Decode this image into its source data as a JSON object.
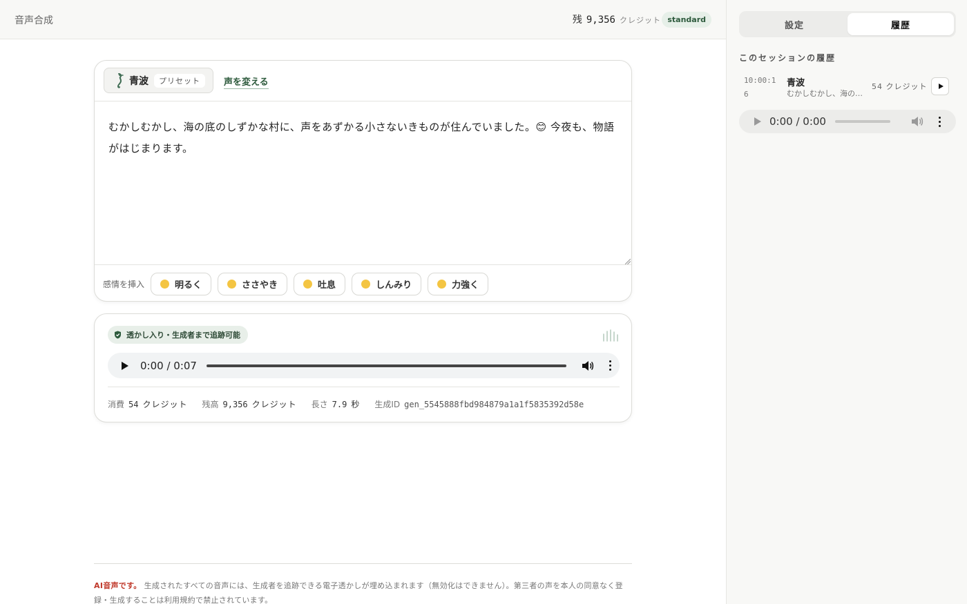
{
  "header": {
    "app_title": "音声合成",
    "credits_prefix": "残",
    "credits_value": "9,356",
    "credits_unit": "クレジット",
    "plan": "standard"
  },
  "editor": {
    "voice_name": "青波",
    "voice_tag": "プリセット",
    "change_voice": "声を変える",
    "text": "むかしむかし、海の底のしずかな村に、声をあずかる小さないきものが住んでいました。😊 今夜も、物語がはじまります。",
    "emotion_label": "感情を挿入",
    "emotions": [
      {
        "label": "明るく",
        "icon": "bright-face-icon",
        "color": "#f4c542"
      },
      {
        "label": "ささやき",
        "icon": "whisper-face-icon",
        "color": "#f4c542"
      },
      {
        "label": "吐息",
        "icon": "sigh-face-icon",
        "color": "#f4c542"
      },
      {
        "label": "しんみり",
        "icon": "sad-face-icon",
        "color": "#f4c542"
      },
      {
        "label": "力強く",
        "icon": "strong-face-icon",
        "color": "#f4c542"
      }
    ]
  },
  "output": {
    "watermark_badge": "透かし入り・生成者まで追跡可能",
    "player_time": "0:00 / 0:07",
    "meta": {
      "cost_label": "消費",
      "cost_value": "54",
      "cost_unit": "クレジット",
      "balance_label": "残高",
      "balance_value": "9,356",
      "balance_unit": "クレジット",
      "length_label": "長さ",
      "length_value": "7.9",
      "length_unit": "秒",
      "id_label": "生成ID",
      "id_value": "gen_5545888fbd984879a1a1f5835392d58e"
    }
  },
  "footer": {
    "ai_label": "AI音声です。",
    "notice": "生成されたすべての音声には、生成者を追跡できる電子透かしが埋め込まれます（無効化はできません）。第三者の声を本人の同意なく登録・生成することは利用規約で禁止されています。"
  },
  "panel": {
    "tabs": [
      {
        "label": "設定",
        "active": false
      },
      {
        "label": "履歴",
        "active": true
      }
    ],
    "history_title": "このセッションの履歴",
    "history": [
      {
        "time": "10:00:16",
        "name": "青波",
        "snippet": "むかしむかし、海の底のしずかな村に",
        "cost": "54 クレジット"
      }
    ],
    "mini_player_time": "0:00 / 0:00"
  },
  "colors": {
    "accent": "#2d5a3c",
    "badge_bg": "#e8efe9",
    "ai_warning": "#c0392b"
  }
}
